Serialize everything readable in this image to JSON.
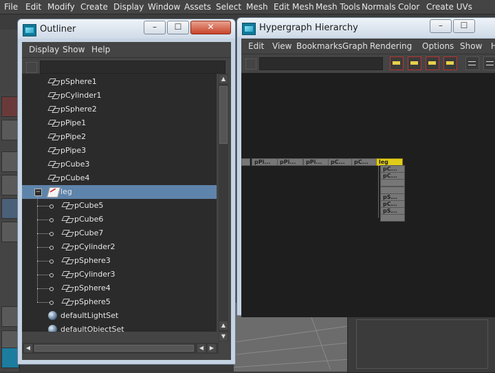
{
  "main_menu": [
    "File",
    "Edit",
    "Modify",
    "Create",
    "Display",
    "Window",
    "Assets",
    "Select",
    "Mesh",
    "Edit Mesh",
    "Mesh Tools",
    "Normals",
    "Color",
    "Create UVs"
  ],
  "outliner": {
    "title": "Outliner",
    "menus": [
      "Display",
      "Show",
      "Help"
    ],
    "filter_value": "",
    "items": [
      {
        "label": "pSphere1",
        "icon": "mesh-icon",
        "depth": 0
      },
      {
        "label": "pCylinder1",
        "icon": "mesh-icon",
        "depth": 0
      },
      {
        "label": "pSphere2",
        "icon": "mesh-icon",
        "depth": 0
      },
      {
        "label": "pPipe1",
        "icon": "mesh-icon",
        "depth": 0
      },
      {
        "label": "pPipe2",
        "icon": "mesh-icon",
        "depth": 0
      },
      {
        "label": "pPipe3",
        "icon": "mesh-icon",
        "depth": 0
      },
      {
        "label": "pCube3",
        "icon": "mesh-icon",
        "depth": 0
      },
      {
        "label": "pCube4",
        "icon": "mesh-icon",
        "depth": 0
      },
      {
        "label": "leg",
        "icon": "group-icon",
        "depth": 0,
        "selected": true,
        "expanded": true
      },
      {
        "label": "pCube5",
        "icon": "mesh-icon",
        "depth": 1
      },
      {
        "label": "pCube6",
        "icon": "mesh-icon",
        "depth": 1
      },
      {
        "label": "pCube7",
        "icon": "mesh-icon",
        "depth": 1
      },
      {
        "label": "pCylinder2",
        "icon": "mesh-icon",
        "depth": 1
      },
      {
        "label": "pSphere3",
        "icon": "mesh-icon",
        "depth": 1
      },
      {
        "label": "pCylinder3",
        "icon": "mesh-icon",
        "depth": 1
      },
      {
        "label": "pSphere4",
        "icon": "mesh-icon",
        "depth": 1
      },
      {
        "label": "pSphere5",
        "icon": "mesh-icon",
        "depth": 1
      },
      {
        "label": "defaultLightSet",
        "icon": "set-icon",
        "depth": 0
      },
      {
        "label": "defaultObjectSet",
        "icon": "set-icon",
        "depth": 0
      }
    ],
    "selection_color": "#5f84ab"
  },
  "hypergraph": {
    "title": "Hypergraph Hierarchy",
    "menus": [
      "Edit",
      "View",
      "Bookmarks",
      "Graph",
      "Rendering",
      "Options",
      "Show",
      "Help"
    ],
    "filter_value": "",
    "top_nodes": [
      "",
      "pPi...",
      "pPi...",
      "pPi...",
      "pC...",
      "pC...",
      "leg"
    ],
    "child_nodes": [
      "pC...",
      "pC...",
      "",
      "",
      "pS...",
      "pC...",
      "pS...",
      ""
    ],
    "selected_node_color": "#e0cd1a"
  },
  "window_buttons": {
    "minimize": "–",
    "maximize": "☐",
    "close": "✕"
  }
}
